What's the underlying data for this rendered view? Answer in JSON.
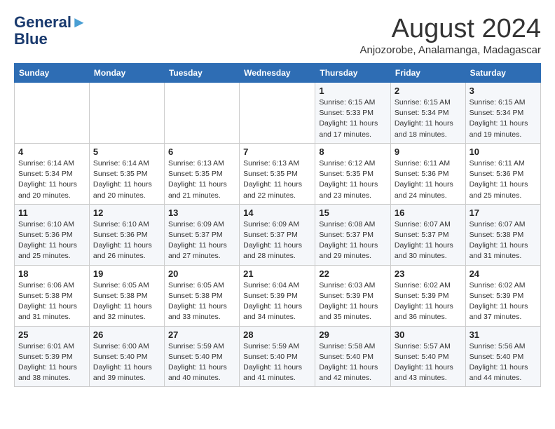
{
  "header": {
    "logo_line1": "General",
    "logo_line2": "Blue",
    "month_year": "August 2024",
    "location": "Anjozorobe, Analamanga, Madagascar"
  },
  "columns": [
    "Sunday",
    "Monday",
    "Tuesday",
    "Wednesday",
    "Thursday",
    "Friday",
    "Saturday"
  ],
  "weeks": [
    [
      {
        "day": "",
        "info": ""
      },
      {
        "day": "",
        "info": ""
      },
      {
        "day": "",
        "info": ""
      },
      {
        "day": "",
        "info": ""
      },
      {
        "day": "1",
        "info": "Sunrise: 6:15 AM\nSunset: 5:33 PM\nDaylight: 11 hours\nand 17 minutes."
      },
      {
        "day": "2",
        "info": "Sunrise: 6:15 AM\nSunset: 5:34 PM\nDaylight: 11 hours\nand 18 minutes."
      },
      {
        "day": "3",
        "info": "Sunrise: 6:15 AM\nSunset: 5:34 PM\nDaylight: 11 hours\nand 19 minutes."
      }
    ],
    [
      {
        "day": "4",
        "info": "Sunrise: 6:14 AM\nSunset: 5:34 PM\nDaylight: 11 hours\nand 20 minutes."
      },
      {
        "day": "5",
        "info": "Sunrise: 6:14 AM\nSunset: 5:35 PM\nDaylight: 11 hours\nand 20 minutes."
      },
      {
        "day": "6",
        "info": "Sunrise: 6:13 AM\nSunset: 5:35 PM\nDaylight: 11 hours\nand 21 minutes."
      },
      {
        "day": "7",
        "info": "Sunrise: 6:13 AM\nSunset: 5:35 PM\nDaylight: 11 hours\nand 22 minutes."
      },
      {
        "day": "8",
        "info": "Sunrise: 6:12 AM\nSunset: 5:35 PM\nDaylight: 11 hours\nand 23 minutes."
      },
      {
        "day": "9",
        "info": "Sunrise: 6:11 AM\nSunset: 5:36 PM\nDaylight: 11 hours\nand 24 minutes."
      },
      {
        "day": "10",
        "info": "Sunrise: 6:11 AM\nSunset: 5:36 PM\nDaylight: 11 hours\nand 25 minutes."
      }
    ],
    [
      {
        "day": "11",
        "info": "Sunrise: 6:10 AM\nSunset: 5:36 PM\nDaylight: 11 hours\nand 25 minutes."
      },
      {
        "day": "12",
        "info": "Sunrise: 6:10 AM\nSunset: 5:36 PM\nDaylight: 11 hours\nand 26 minutes."
      },
      {
        "day": "13",
        "info": "Sunrise: 6:09 AM\nSunset: 5:37 PM\nDaylight: 11 hours\nand 27 minutes."
      },
      {
        "day": "14",
        "info": "Sunrise: 6:09 AM\nSunset: 5:37 PM\nDaylight: 11 hours\nand 28 minutes."
      },
      {
        "day": "15",
        "info": "Sunrise: 6:08 AM\nSunset: 5:37 PM\nDaylight: 11 hours\nand 29 minutes."
      },
      {
        "day": "16",
        "info": "Sunrise: 6:07 AM\nSunset: 5:37 PM\nDaylight: 11 hours\nand 30 minutes."
      },
      {
        "day": "17",
        "info": "Sunrise: 6:07 AM\nSunset: 5:38 PM\nDaylight: 11 hours\nand 31 minutes."
      }
    ],
    [
      {
        "day": "18",
        "info": "Sunrise: 6:06 AM\nSunset: 5:38 PM\nDaylight: 11 hours\nand 31 minutes."
      },
      {
        "day": "19",
        "info": "Sunrise: 6:05 AM\nSunset: 5:38 PM\nDaylight: 11 hours\nand 32 minutes."
      },
      {
        "day": "20",
        "info": "Sunrise: 6:05 AM\nSunset: 5:38 PM\nDaylight: 11 hours\nand 33 minutes."
      },
      {
        "day": "21",
        "info": "Sunrise: 6:04 AM\nSunset: 5:39 PM\nDaylight: 11 hours\nand 34 minutes."
      },
      {
        "day": "22",
        "info": "Sunrise: 6:03 AM\nSunset: 5:39 PM\nDaylight: 11 hours\nand 35 minutes."
      },
      {
        "day": "23",
        "info": "Sunrise: 6:02 AM\nSunset: 5:39 PM\nDaylight: 11 hours\nand 36 minutes."
      },
      {
        "day": "24",
        "info": "Sunrise: 6:02 AM\nSunset: 5:39 PM\nDaylight: 11 hours\nand 37 minutes."
      }
    ],
    [
      {
        "day": "25",
        "info": "Sunrise: 6:01 AM\nSunset: 5:39 PM\nDaylight: 11 hours\nand 38 minutes."
      },
      {
        "day": "26",
        "info": "Sunrise: 6:00 AM\nSunset: 5:40 PM\nDaylight: 11 hours\nand 39 minutes."
      },
      {
        "day": "27",
        "info": "Sunrise: 5:59 AM\nSunset: 5:40 PM\nDaylight: 11 hours\nand 40 minutes."
      },
      {
        "day": "28",
        "info": "Sunrise: 5:59 AM\nSunset: 5:40 PM\nDaylight: 11 hours\nand 41 minutes."
      },
      {
        "day": "29",
        "info": "Sunrise: 5:58 AM\nSunset: 5:40 PM\nDaylight: 11 hours\nand 42 minutes."
      },
      {
        "day": "30",
        "info": "Sunrise: 5:57 AM\nSunset: 5:40 PM\nDaylight: 11 hours\nand 43 minutes."
      },
      {
        "day": "31",
        "info": "Sunrise: 5:56 AM\nSunset: 5:40 PM\nDaylight: 11 hours\nand 44 minutes."
      }
    ]
  ]
}
